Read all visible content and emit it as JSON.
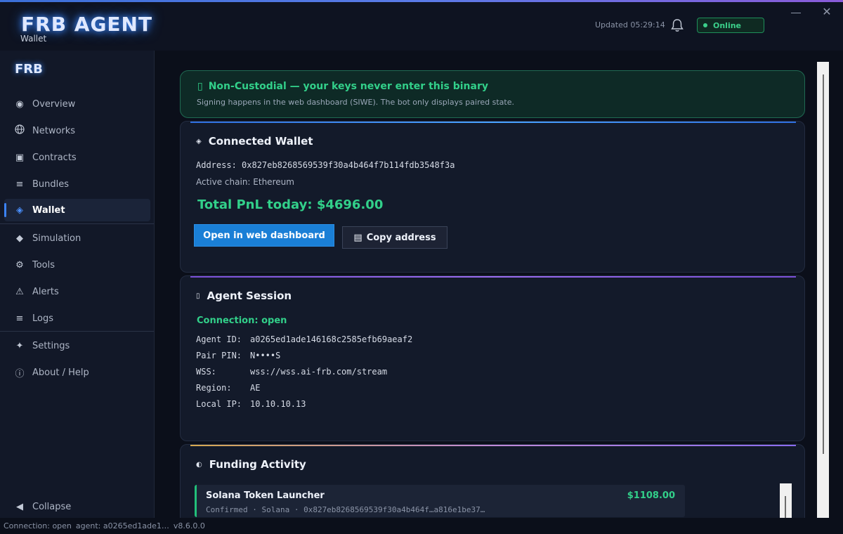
{
  "app": {
    "title": "FRB AGENT",
    "subtitle": "Wallet",
    "updated": "Updated 05:29:14",
    "status": "Online"
  },
  "sidebar": {
    "logo": "FRB",
    "items": [
      {
        "label": "Overview",
        "icon": "◉"
      },
      {
        "label": "Networks",
        "icon": "🌐"
      },
      {
        "label": "Contracts",
        "icon": "▣"
      },
      {
        "label": "Bundles",
        "icon": "≡"
      },
      {
        "label": "Wallet",
        "icon": "◈",
        "active": true
      },
      {
        "label": "Simulation",
        "icon": "◆"
      },
      {
        "label": "Tools",
        "icon": "⚙"
      },
      {
        "label": "Alerts",
        "icon": "⚠"
      },
      {
        "label": "Logs",
        "icon": "≡"
      },
      {
        "label": "Settings",
        "icon": "✦"
      },
      {
        "label": "About / Help",
        "icon": "ⓘ"
      }
    ],
    "collapse": "Collapse"
  },
  "banner": {
    "title": "Non-Custodial — your keys never enter this binary",
    "subtitle": "Signing happens in the web dashboard (SIWE). The bot only displays paired state."
  },
  "wallet": {
    "title": "Connected Wallet",
    "address": "Address: 0x827eb8268569539f30a4b464f7b114fdb3548f3a",
    "chain": "Active chain: Ethereum",
    "pnl": "Total PnL today: $4696.00",
    "open_btn": "Open in web dashboard",
    "copy_btn": "Copy address"
  },
  "session": {
    "title": "Agent Session",
    "connection": "Connection:  open",
    "rows": [
      {
        "k": "Agent ID:",
        "v": "a0265ed1ade146168c2585efb69aeaf2"
      },
      {
        "k": "Pair PIN:",
        "v": "N••••S"
      },
      {
        "k": "WSS:",
        "v": "wss://wss.ai-frb.com/stream"
      },
      {
        "k": "Region:",
        "v": "AE"
      },
      {
        "k": "Local IP:",
        "v": "10.10.10.13"
      }
    ]
  },
  "funding": {
    "title": "Funding Activity",
    "items": [
      {
        "name": "Solana Token Launcher",
        "amount": "$1108.00",
        "meta": "Confirmed  ·  Solana  ·  0x827eb8268569539f30a4b464f…a816e1be37…"
      }
    ]
  },
  "statusbar": {
    "connection": "Connection: open",
    "agent": "agent: a0265ed1ade1…",
    "version": "v8.6.0.0"
  },
  "colors": {
    "accent": "#3b82f6",
    "success": "#32d08a",
    "primary_button": "#1a7fd6"
  }
}
